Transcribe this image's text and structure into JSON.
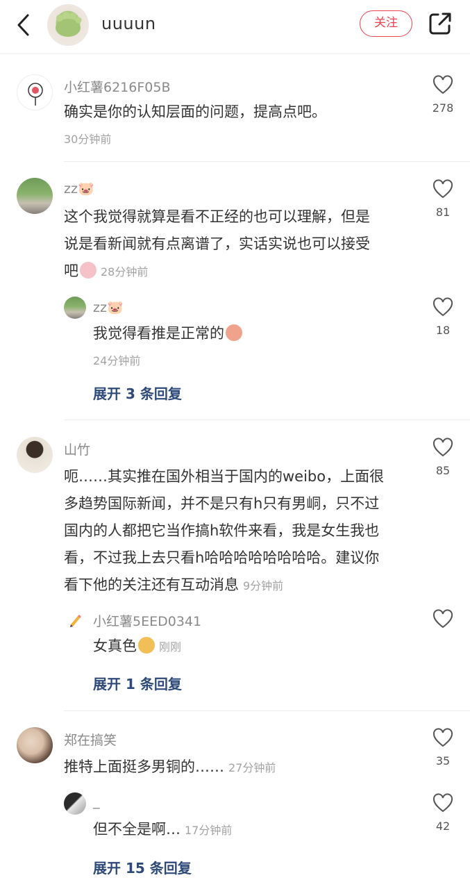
{
  "header": {
    "author_name": "uuuun",
    "follow_label": "关注"
  },
  "comments": [
    {
      "user": "小红薯6216F05B",
      "text": "确实是你的认知层面的问题，提高点吧。",
      "time": "30分钟前",
      "likes": "278"
    },
    {
      "user": "zz🐷",
      "lines": [
        "这个我觉得就算是看不正经的也可以理解，但是",
        "说是看新闻就有点离谱了，实话实说也可以接受",
        "吧"
      ],
      "time": "28分钟前",
      "likes": "81",
      "reply": {
        "user": "zz🐷",
        "text": "我觉得看推是正常的",
        "time": "24分钟前",
        "likes": "18"
      },
      "expand_label": "展开 3 条回复"
    },
    {
      "user": "山竹",
      "lines": [
        "呃……其实推在国外相当于国内的weibo，上面很",
        "多趋势国际新闻，并不是只有h只有男峒，只不过",
        "国内的人都把它当作搞h软件来看，我是女生我也",
        "看，不过我上去只看h哈哈哈哈哈哈哈哈。建议你",
        "看下他的关注还有互动消息"
      ],
      "time": "9分钟前",
      "likes": "85",
      "reply": {
        "user": "小红薯5EED0341",
        "text": "女真色",
        "time": "刚刚",
        "likes": ""
      },
      "expand_label": "展开 1 条回复"
    },
    {
      "user": "郑在搞笑",
      "text": "推特上面挺多男铜的……",
      "time": "27分钟前",
      "likes": "35",
      "reply": {
        "user": "_",
        "text": "但不全是啊…",
        "time": "17分钟前",
        "likes": "42"
      },
      "expand_label": "展开 15 条回复"
    }
  ]
}
